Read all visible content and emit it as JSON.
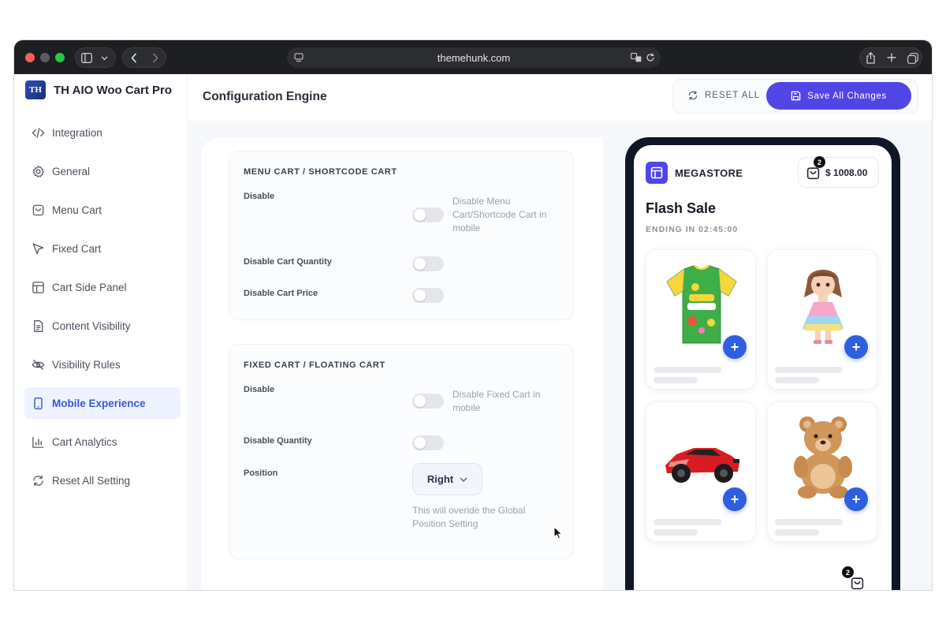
{
  "browser": {
    "url": "themehunk.com"
  },
  "sidebar": {
    "brand": {
      "logo_text": "TH",
      "title": "TH AIO Woo Cart Pro"
    },
    "items": [
      {
        "label": "Integration",
        "icon": "code-icon",
        "active": false
      },
      {
        "label": "General",
        "icon": "gear-icon",
        "active": false
      },
      {
        "label": "Menu Cart",
        "icon": "bag-icon",
        "active": false
      },
      {
        "label": "Fixed Cart",
        "icon": "pointer-icon",
        "active": false
      },
      {
        "label": "Cart Side Panel",
        "icon": "layout-icon",
        "active": false
      },
      {
        "label": "Content Visibility",
        "icon": "document-icon",
        "active": false
      },
      {
        "label": "Visibility Rules",
        "icon": "eye-off-icon",
        "active": false
      },
      {
        "label": "Mobile Experience",
        "icon": "mobile-icon",
        "active": true
      },
      {
        "label": "Cart Analytics",
        "icon": "bar-chart-icon",
        "active": false
      },
      {
        "label": "Reset All Setting",
        "icon": "refresh-icon",
        "active": false
      }
    ]
  },
  "header": {
    "title": "Configuration Engine",
    "reset_label": "RESET ALL",
    "save_label": "Save All Changes"
  },
  "menu_cart": {
    "title": "MENU CART / SHORTCODE CART",
    "disable_label": "Disable",
    "disable_hint": "Disable Menu Cart/Shortcode Cart in mobile",
    "qty_label": "Disable Cart Quantity",
    "price_label": "Disable Cart Price"
  },
  "fixed_cart": {
    "title": "FIXED CART / FLOATING CART",
    "disable_label": "Disable",
    "disable_hint": "Disable Fixed Cart in mobile",
    "qty_label": "Disable Quantity",
    "position_label": "Position",
    "position_value": "Right",
    "position_hint": "This will overide the Global Position Setting"
  },
  "preview": {
    "store_name": "MEGASTORE",
    "cart_count": "2",
    "cart_total": "$ 1008.00",
    "sale_title": "Flash Sale",
    "sale_ending": "ENDING IN 02:45:00",
    "add_label": "+",
    "float_cart_count": "2"
  },
  "colors": {
    "accent": "#4f46e5",
    "active_nav_bg": "#eef3ff",
    "add_button": "#2f5fe0",
    "phone_frame": "#0f1628"
  }
}
